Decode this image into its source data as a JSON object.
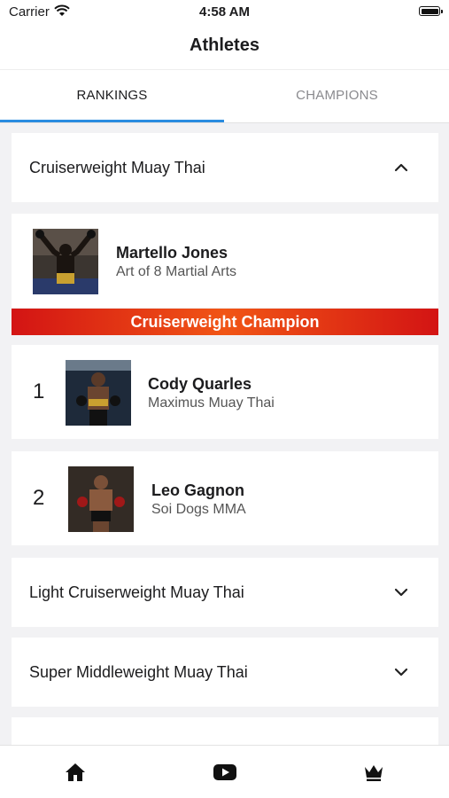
{
  "status_bar": {
    "carrier": "Carrier",
    "time": "4:58 AM"
  },
  "nav": {
    "title": "Athletes"
  },
  "tabs": [
    {
      "label": "RANKINGS",
      "selected": true
    },
    {
      "label": "CHAMPIONS",
      "selected": false
    }
  ],
  "accent_color": "#2a8ce0",
  "divisions": [
    {
      "name": "Cruiserweight Muay Thai",
      "expanded": true
    },
    {
      "name": "Light Cruiserweight Muay Thai",
      "expanded": false
    },
    {
      "name": "Super Middleweight Muay Thai",
      "expanded": false
    }
  ],
  "champion": {
    "name": "Martello Jones",
    "gym": "Art of 8 Martial Arts",
    "banner": "Cruiserweight Champion"
  },
  "rankings": [
    {
      "rank": "1",
      "name": "Cody Quarles",
      "gym": "Maximus Muay Thai"
    },
    {
      "rank": "2",
      "name": "Leo Gagnon",
      "gym": "Soi Dogs MMA"
    }
  ],
  "tabbar": {
    "icons": [
      "home-icon",
      "youtube-icon",
      "crown-icon"
    ]
  }
}
